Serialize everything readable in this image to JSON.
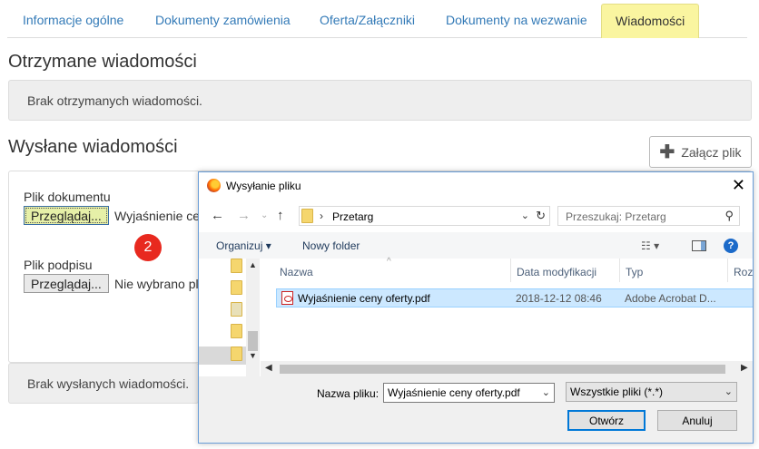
{
  "tabs": [
    "Informacje ogólne",
    "Dokumenty zamówienia",
    "Oferta/Załączniki",
    "Dokumenty na wezwanie",
    "Wiadomości"
  ],
  "received": {
    "title": "Otrzymane wiadomości",
    "empty": "Brak otrzymanych wiadomości."
  },
  "sent": {
    "title": "Wysłane wiadomości",
    "empty": "Brak wysłanych wiadomości."
  },
  "attach_label": "Załącz plik",
  "form": {
    "doc_label": "Plik dokumentu",
    "browse_label": "Przeglądaj...",
    "doc_filename": "Wyjaśnienie ce",
    "sig_label": "Plik podpisu",
    "sig_filename": "Nie wybrano pl"
  },
  "step_badge": "2",
  "dialog": {
    "title": "Wysyłanie pliku",
    "path": "Przetarg",
    "search_placeholder": "Przeszukaj: Przetarg",
    "organize": "Organizuj",
    "new_folder": "Nowy folder",
    "columns": [
      "Nazwa",
      "Data modyfikacji",
      "Typ",
      "Roz"
    ],
    "files": [
      {
        "name": "Wyjaśnienie ceny oferty.pdf",
        "modified": "2018-12-12 08:46",
        "type": "Adobe Acrobat D..."
      }
    ],
    "filename_label": "Nazwa pliku:",
    "filename_value": "Wyjaśnienie ceny oferty.pdf",
    "filter": "Wszystkie pliki (*.*)",
    "open": "Otwórz",
    "cancel": "Anuluj"
  }
}
